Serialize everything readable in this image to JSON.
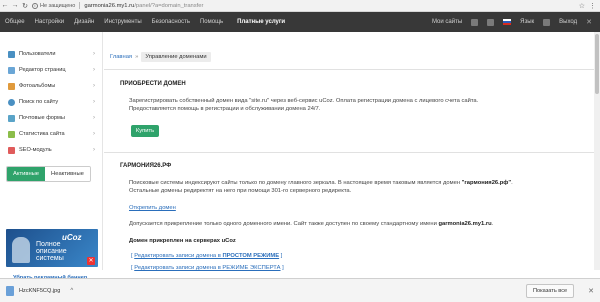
{
  "browser": {
    "security_label": "Не защищено",
    "url_host": "garmonia26.my1.ru",
    "url_path": "/panel/?a=domain_transfer"
  },
  "topnav": {
    "items": [
      "Общее",
      "Настройки",
      "Дизайн",
      "Инструменты",
      "Безопасность",
      "Помощь"
    ],
    "active": "Платные услуги",
    "my_sites": "Мои сайты",
    "language": "Язык",
    "logout": "Выход"
  },
  "sidebar": {
    "items": [
      {
        "label": "Пользователи",
        "icon": "users-icon",
        "color": "#4a90c2"
      },
      {
        "label": "Редактор страниц",
        "icon": "page-editor-icon",
        "color": "#6aa6d6"
      },
      {
        "label": "Фотоальбомы",
        "icon": "photo-album-icon",
        "color": "#e09a3c"
      },
      {
        "label": "Поиск по сайту",
        "icon": "search-icon",
        "color": "#4a90c2"
      },
      {
        "label": "Почтовые формы",
        "icon": "mail-icon",
        "color": "#5aa4c8"
      },
      {
        "label": "Статистика сайта",
        "icon": "statistics-icon",
        "color": "#8bbd4a"
      },
      {
        "label": "SEO-модуль",
        "icon": "seo-icon",
        "color": "#e05b5b"
      }
    ],
    "toggle_active": "Активные",
    "toggle_inactive": "Неактивные",
    "banner_logo": "uCoz",
    "banner_text_1": "Полное",
    "banner_text_2": "описание",
    "banner_text_3": "системы",
    "remove_banner": "Убрать рекламный баннер"
  },
  "breadcrumb": {
    "home": "Главная",
    "current": "Управление доменами"
  },
  "buy_section": {
    "title": "ПРИОБРЕСТИ ДОМЕН",
    "text_1": "Зарегистрировать собственный домен вида \"site.ru\" через веб-сервис uCoz. Оплата регистрации домена с лицевого счета сайта.",
    "text_2": "Предоставляется помощь в регистрации и обслуживании домена 24/7.",
    "button": "Купить"
  },
  "domain_section": {
    "title": "ГАРМОНИЯ26.РФ",
    "text_1_pre": "Поисковые системы индексируют сайты только по домену главного зеркала. В настоящее время таковым является домен ",
    "text_1_bold": "\"гармония26.рф\"",
    "text_1_post": ".",
    "text_2": "Остальные домены редиректят на него при помощи 301-го серверного редиректа.",
    "unlink": "Открепить домен",
    "text_3_pre": "Допускается прикрепление только одного доменного имени. Сайт также доступен по своему стандартному имени ",
    "text_3_bold": "garmonia26.my1.ru",
    "text_3_post": ".",
    "attached": "Домен прикреплен на серверах uCoz",
    "edit_simple_pre": "Редактировать записи домена в ",
    "edit_simple_bold": "ПРОСТОМ РЕЖИМЕ",
    "edit_expert": "Редактировать записи домена в РЕЖИМЕ ЭКСПЕРТА"
  },
  "downloads": {
    "file": "HzcKNF5CQ.jpg",
    "show_all": "Показать все"
  }
}
